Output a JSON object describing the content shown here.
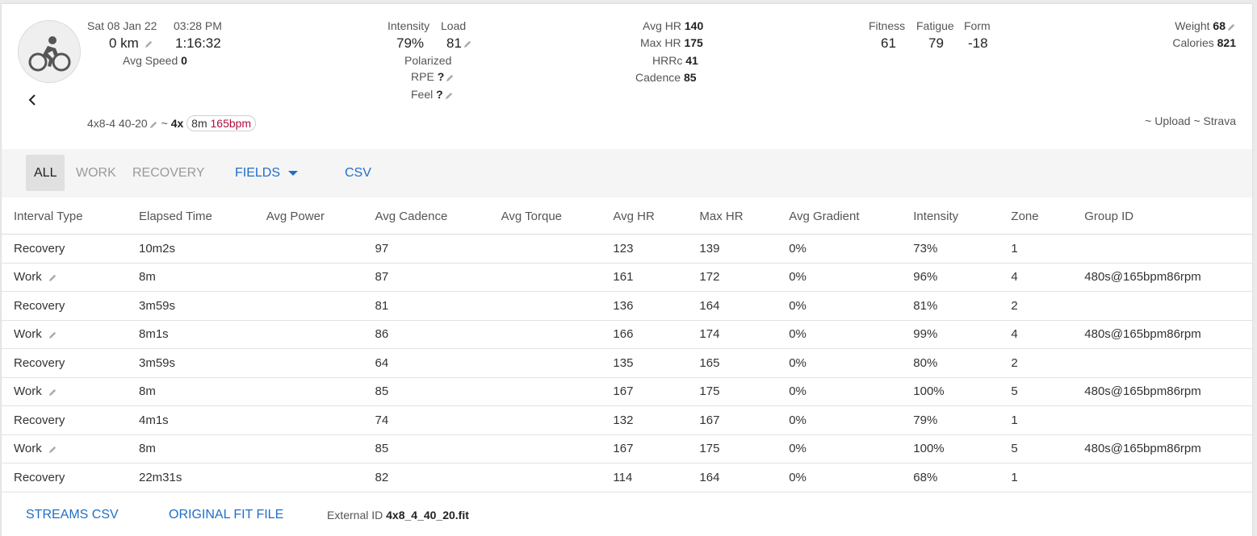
{
  "activity": {
    "date": "Sat 08 Jan 22",
    "time": "03:28 PM",
    "distance": "0 km",
    "duration": "1:16:32",
    "avg_speed_label": "Avg Speed",
    "avg_speed": "0",
    "icon": "bicycle-icon",
    "workout_name": "4x8-4 40-20",
    "tilde": "~",
    "interval_count": "4x",
    "interval_duration": "8m",
    "interval_hr": "165bpm",
    "links_text": "~ Upload ~ Strava"
  },
  "intensity": {
    "intensity_label": "Intensity",
    "intensity": "79%",
    "load_label": "Load",
    "load": "81",
    "polarized": "Polarized",
    "rpe_label": "RPE",
    "rpe": "?",
    "feel_label": "Feel",
    "feel": "?"
  },
  "hr": {
    "avg_hr_label": "Avg HR",
    "avg_hr": "140",
    "max_hr_label": "Max HR",
    "max_hr": "175",
    "hrrc_label": "HRRc",
    "hrrc": "41",
    "cadence_label": "Cadence",
    "cadence": "85"
  },
  "fitness": {
    "fitness_label": "Fitness",
    "fitness": "61",
    "fatigue_label": "Fatigue",
    "fatigue": "79",
    "form_label": "Form",
    "form": "-18"
  },
  "body": {
    "weight_label": "Weight",
    "weight": "68",
    "calories_label": "Calories",
    "calories": "821"
  },
  "toolbar": {
    "all": "ALL",
    "work": "WORK",
    "recovery": "RECOVERY",
    "fields": "FIELDS",
    "csv": "CSV",
    "accent": "#1e6fc8"
  },
  "table": {
    "columns": [
      "Interval Type",
      "Elapsed Time",
      "Avg Power",
      "Avg Cadence",
      "Avg Torque",
      "Avg HR",
      "Max HR",
      "Avg Gradient",
      "Intensity",
      "Zone",
      "Group ID"
    ],
    "rows": [
      {
        "type": "Recovery",
        "elapsed": "10m2s",
        "power": "",
        "cadence": "97",
        "torque": "",
        "avg_hr": "123",
        "max_hr": "139",
        "gradient": "0%",
        "intensity": "73%",
        "zone": "1",
        "group": ""
      },
      {
        "type": "Work",
        "elapsed": "8m",
        "power": "",
        "cadence": "87",
        "torque": "",
        "avg_hr": "161",
        "max_hr": "172",
        "gradient": "0%",
        "intensity": "96%",
        "zone": "4",
        "group": "480s@165bpm86rpm"
      },
      {
        "type": "Recovery",
        "elapsed": "3m59s",
        "power": "",
        "cadence": "81",
        "torque": "",
        "avg_hr": "136",
        "max_hr": "164",
        "gradient": "0%",
        "intensity": "81%",
        "zone": "2",
        "group": ""
      },
      {
        "type": "Work",
        "elapsed": "8m1s",
        "power": "",
        "cadence": "86",
        "torque": "",
        "avg_hr": "166",
        "max_hr": "174",
        "gradient": "0%",
        "intensity": "99%",
        "zone": "4",
        "group": "480s@165bpm86rpm"
      },
      {
        "type": "Recovery",
        "elapsed": "3m59s",
        "power": "",
        "cadence": "64",
        "torque": "",
        "avg_hr": "135",
        "max_hr": "165",
        "gradient": "0%",
        "intensity": "80%",
        "zone": "2",
        "group": ""
      },
      {
        "type": "Work",
        "elapsed": "8m",
        "power": "",
        "cadence": "85",
        "torque": "",
        "avg_hr": "167",
        "max_hr": "175",
        "gradient": "0%",
        "intensity": "100%",
        "zone": "5",
        "group": "480s@165bpm86rpm"
      },
      {
        "type": "Recovery",
        "elapsed": "4m1s",
        "power": "",
        "cadence": "74",
        "torque": "",
        "avg_hr": "132",
        "max_hr": "167",
        "gradient": "0%",
        "intensity": "79%",
        "zone": "1",
        "group": ""
      },
      {
        "type": "Work",
        "elapsed": "8m",
        "power": "",
        "cadence": "85",
        "torque": "",
        "avg_hr": "167",
        "max_hr": "175",
        "gradient": "0%",
        "intensity": "100%",
        "zone": "5",
        "group": "480s@165bpm86rpm"
      },
      {
        "type": "Recovery",
        "elapsed": "22m31s",
        "power": "",
        "cadence": "82",
        "torque": "",
        "avg_hr": "114",
        "max_hr": "164",
        "gradient": "0%",
        "intensity": "68%",
        "zone": "1",
        "group": ""
      }
    ]
  },
  "footer": {
    "streams_csv": "STREAMS CSV",
    "original_fit": "ORIGINAL FIT FILE",
    "external_id_label": "External ID",
    "external_id": "4x8_4_40_20.fit"
  }
}
